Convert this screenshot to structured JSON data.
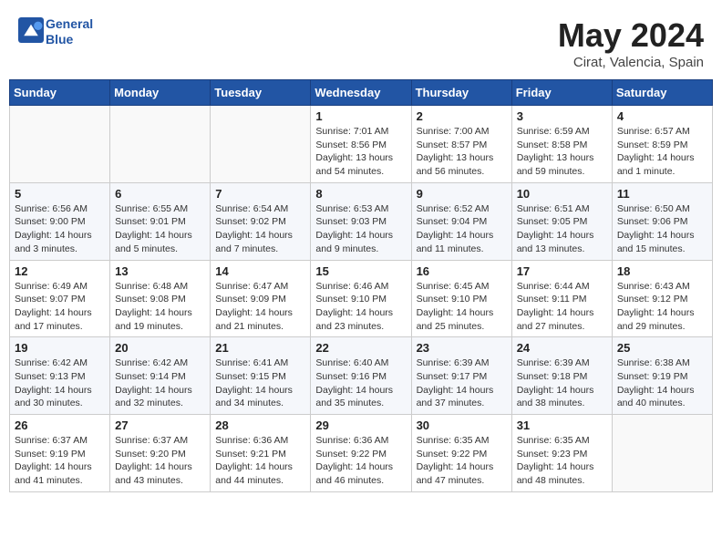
{
  "header": {
    "logo_line1": "General",
    "logo_line2": "Blue",
    "month": "May 2024",
    "location": "Cirat, Valencia, Spain"
  },
  "weekdays": [
    "Sunday",
    "Monday",
    "Tuesday",
    "Wednesday",
    "Thursday",
    "Friday",
    "Saturday"
  ],
  "weeks": [
    [
      {
        "day": "",
        "info": ""
      },
      {
        "day": "",
        "info": ""
      },
      {
        "day": "",
        "info": ""
      },
      {
        "day": "1",
        "info": "Sunrise: 7:01 AM\nSunset: 8:56 PM\nDaylight: 13 hours\nand 54 minutes."
      },
      {
        "day": "2",
        "info": "Sunrise: 7:00 AM\nSunset: 8:57 PM\nDaylight: 13 hours\nand 56 minutes."
      },
      {
        "day": "3",
        "info": "Sunrise: 6:59 AM\nSunset: 8:58 PM\nDaylight: 13 hours\nand 59 minutes."
      },
      {
        "day": "4",
        "info": "Sunrise: 6:57 AM\nSunset: 8:59 PM\nDaylight: 14 hours\nand 1 minute."
      }
    ],
    [
      {
        "day": "5",
        "info": "Sunrise: 6:56 AM\nSunset: 9:00 PM\nDaylight: 14 hours\nand 3 minutes."
      },
      {
        "day": "6",
        "info": "Sunrise: 6:55 AM\nSunset: 9:01 PM\nDaylight: 14 hours\nand 5 minutes."
      },
      {
        "day": "7",
        "info": "Sunrise: 6:54 AM\nSunset: 9:02 PM\nDaylight: 14 hours\nand 7 minutes."
      },
      {
        "day": "8",
        "info": "Sunrise: 6:53 AM\nSunset: 9:03 PM\nDaylight: 14 hours\nand 9 minutes."
      },
      {
        "day": "9",
        "info": "Sunrise: 6:52 AM\nSunset: 9:04 PM\nDaylight: 14 hours\nand 11 minutes."
      },
      {
        "day": "10",
        "info": "Sunrise: 6:51 AM\nSunset: 9:05 PM\nDaylight: 14 hours\nand 13 minutes."
      },
      {
        "day": "11",
        "info": "Sunrise: 6:50 AM\nSunset: 9:06 PM\nDaylight: 14 hours\nand 15 minutes."
      }
    ],
    [
      {
        "day": "12",
        "info": "Sunrise: 6:49 AM\nSunset: 9:07 PM\nDaylight: 14 hours\nand 17 minutes."
      },
      {
        "day": "13",
        "info": "Sunrise: 6:48 AM\nSunset: 9:08 PM\nDaylight: 14 hours\nand 19 minutes."
      },
      {
        "day": "14",
        "info": "Sunrise: 6:47 AM\nSunset: 9:09 PM\nDaylight: 14 hours\nand 21 minutes."
      },
      {
        "day": "15",
        "info": "Sunrise: 6:46 AM\nSunset: 9:10 PM\nDaylight: 14 hours\nand 23 minutes."
      },
      {
        "day": "16",
        "info": "Sunrise: 6:45 AM\nSunset: 9:10 PM\nDaylight: 14 hours\nand 25 minutes."
      },
      {
        "day": "17",
        "info": "Sunrise: 6:44 AM\nSunset: 9:11 PM\nDaylight: 14 hours\nand 27 minutes."
      },
      {
        "day": "18",
        "info": "Sunrise: 6:43 AM\nSunset: 9:12 PM\nDaylight: 14 hours\nand 29 minutes."
      }
    ],
    [
      {
        "day": "19",
        "info": "Sunrise: 6:42 AM\nSunset: 9:13 PM\nDaylight: 14 hours\nand 30 minutes."
      },
      {
        "day": "20",
        "info": "Sunrise: 6:42 AM\nSunset: 9:14 PM\nDaylight: 14 hours\nand 32 minutes."
      },
      {
        "day": "21",
        "info": "Sunrise: 6:41 AM\nSunset: 9:15 PM\nDaylight: 14 hours\nand 34 minutes."
      },
      {
        "day": "22",
        "info": "Sunrise: 6:40 AM\nSunset: 9:16 PM\nDaylight: 14 hours\nand 35 minutes."
      },
      {
        "day": "23",
        "info": "Sunrise: 6:39 AM\nSunset: 9:17 PM\nDaylight: 14 hours\nand 37 minutes."
      },
      {
        "day": "24",
        "info": "Sunrise: 6:39 AM\nSunset: 9:18 PM\nDaylight: 14 hours\nand 38 minutes."
      },
      {
        "day": "25",
        "info": "Sunrise: 6:38 AM\nSunset: 9:19 PM\nDaylight: 14 hours\nand 40 minutes."
      }
    ],
    [
      {
        "day": "26",
        "info": "Sunrise: 6:37 AM\nSunset: 9:19 PM\nDaylight: 14 hours\nand 41 minutes."
      },
      {
        "day": "27",
        "info": "Sunrise: 6:37 AM\nSunset: 9:20 PM\nDaylight: 14 hours\nand 43 minutes."
      },
      {
        "day": "28",
        "info": "Sunrise: 6:36 AM\nSunset: 9:21 PM\nDaylight: 14 hours\nand 44 minutes."
      },
      {
        "day": "29",
        "info": "Sunrise: 6:36 AM\nSunset: 9:22 PM\nDaylight: 14 hours\nand 46 minutes."
      },
      {
        "day": "30",
        "info": "Sunrise: 6:35 AM\nSunset: 9:22 PM\nDaylight: 14 hours\nand 47 minutes."
      },
      {
        "day": "31",
        "info": "Sunrise: 6:35 AM\nSunset: 9:23 PM\nDaylight: 14 hours\nand 48 minutes."
      },
      {
        "day": "",
        "info": ""
      }
    ]
  ]
}
